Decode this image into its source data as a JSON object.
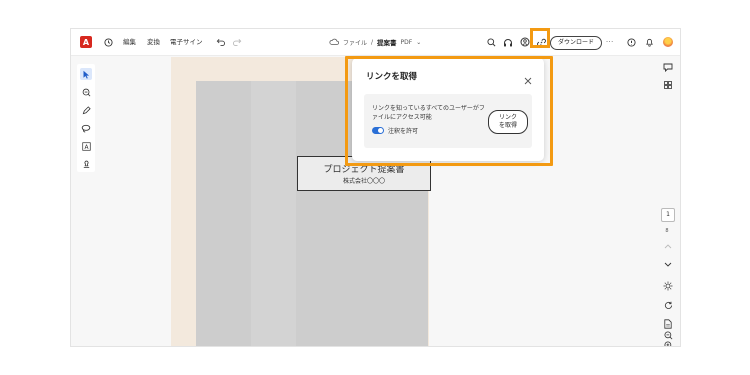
{
  "toolbar": {
    "logo_glyph": "A",
    "menu": [
      "編集",
      "変換",
      "電子サイン"
    ],
    "file": {
      "folder": "ファイル",
      "separator": "/",
      "name": "提案書",
      "ext": "PDF",
      "chevron": "⌄"
    },
    "download_label": "ダウンロード",
    "more_glyph": "···"
  },
  "document": {
    "title": "プロジェクト提案書",
    "company": "株式会社〇〇〇"
  },
  "popup": {
    "title": "リンクを取得",
    "description": "リンクを知っているすべてのユーザーがファイルにアクセス可能",
    "toggle_label": "注釈を許可",
    "toggle_on": true,
    "button_line1": "リンク",
    "button_line2": "を取得"
  },
  "page_nav": {
    "current": "1",
    "total": "8"
  },
  "colors": {
    "accent": "#f39a12",
    "brand": "#d7281f",
    "toggle": "#2a6fd6",
    "doc_bg": "#f3e9dd"
  },
  "icons": {
    "toolbar": [
      "acrobat-logo",
      "history-icon",
      "undo-icon",
      "redo-icon",
      "cloud-icon",
      "search-icon",
      "headphones-icon",
      "share-icon",
      "link-icon",
      "help-icon",
      "bell-icon",
      "avatar"
    ],
    "left_rail": [
      "select-icon",
      "zoom-comment-icon",
      "pen-icon",
      "lasso-icon",
      "text-icon",
      "stamp-icon"
    ],
    "right_rail": [
      "comment-icon",
      "grid-icon",
      "chevron-up-icon",
      "chevron-down-icon",
      "brightness-icon",
      "refresh-icon",
      "page-icon",
      "zoom-in-icon",
      "zoom-out-icon"
    ]
  }
}
